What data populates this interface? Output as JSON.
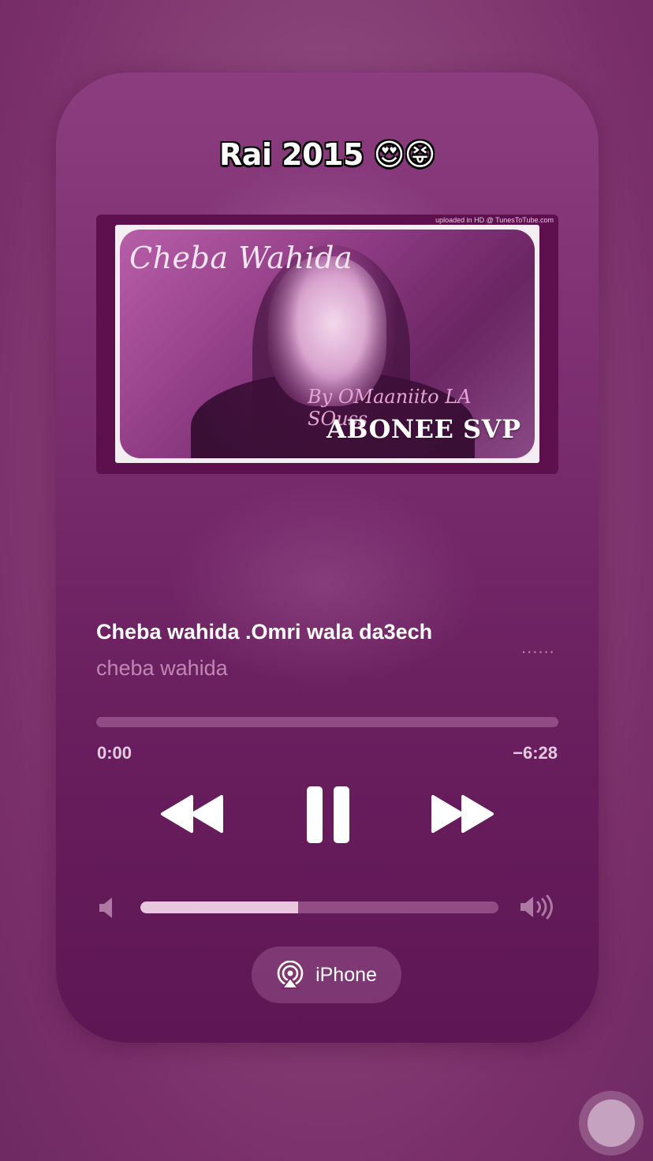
{
  "playlist_title": "Rai 2015 😍😝",
  "artwork": {
    "credit": "uploaded in HD @ TunesToTube.com",
    "name_text": "Cheba Wahida",
    "by_text": "By OMaaniito LA SOuss",
    "subscribe_text": "ABONEE SVP"
  },
  "track": {
    "title": "Cheba wahida .Omri wala da3ech",
    "artist": "cheba wahida",
    "more_glyph": "......"
  },
  "progress": {
    "elapsed": "0:00",
    "remaining": "−6:28",
    "fraction": 0.0
  },
  "volume": {
    "fraction": 0.44
  },
  "output": {
    "device_label": "iPhone"
  },
  "icons": {
    "rewind": "rewind-icon",
    "pause": "pause-icon",
    "forward": "fast-forward-icon",
    "volume_low": "speaker-low-icon",
    "volume_high": "speaker-high-icon",
    "airplay": "airplay-icon",
    "assistive": "assistive-touch-icon"
  },
  "colors": {
    "background": "#874176",
    "card": "#7d2f72",
    "text": "#ffffff"
  }
}
